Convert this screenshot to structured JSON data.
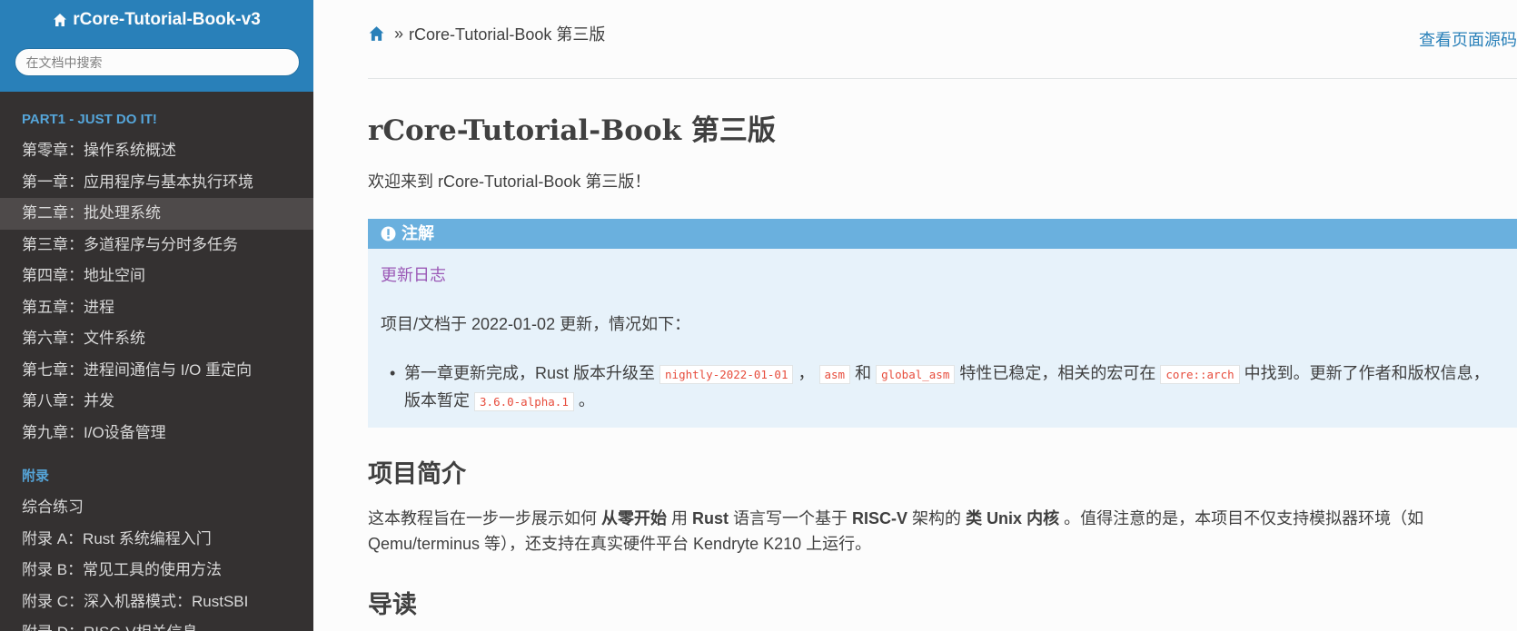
{
  "sidebar": {
    "brand": "rCore-Tutorial-Book-v3",
    "search_placeholder": "在文档中搜索",
    "caption_part1": "PART1 - JUST DO IT!",
    "part1_items": [
      {
        "label": "第零章：操作系统概述"
      },
      {
        "label": "第一章：应用程序与基本执行环境"
      },
      {
        "label": "第二章：批处理系统"
      },
      {
        "label": "第三章：多道程序与分时多任务"
      },
      {
        "label": "第四章：地址空间"
      },
      {
        "label": "第五章：进程"
      },
      {
        "label": "第六章：文件系统"
      },
      {
        "label": "第七章：进程间通信与 I/O 重定向"
      },
      {
        "label": "第八章：并发"
      },
      {
        "label": "第九章：I/O设备管理"
      }
    ],
    "caption_appendix": "附录",
    "appendix_items": [
      {
        "label": "综合练习"
      },
      {
        "label": "附录 A：Rust 系统编程入门"
      },
      {
        "label": "附录 B：常见工具的使用方法"
      },
      {
        "label": "附录 C：深入机器模式：RustSBI"
      },
      {
        "label": "附录 D：RISC-V相关信息"
      }
    ]
  },
  "main": {
    "breadcrumb_sep": "»",
    "breadcrumb_current": "rCore-Tutorial-Book 第三版",
    "view_source": "查看页面源码",
    "title": "rCore-Tutorial-Book 第三版",
    "welcome": "欢迎来到 rCore-Tutorial-Book 第三版！",
    "note": {
      "title": "注解",
      "link": "更新日志",
      "para": "项目/文档于 2022-01-02 更新，情况如下：",
      "bullet": "•",
      "li_t1": "第一章更新完成，Rust 版本升级至 ",
      "li_c1": "nightly-2022-01-01",
      "li_t2": " ，  ",
      "li_c2": "asm",
      "li_t3": " 和 ",
      "li_c3": "global_asm",
      "li_t4": " 特性已稳定，相关的宏可在 ",
      "li_c4": "core::arch",
      "li_t5": " 中找到。更新了作者和版权信息，版本暂定 ",
      "li_c5": "3.6.0-alpha.1",
      "li_t6": " 。"
    },
    "section1_title": "项目简介",
    "intro": {
      "t1": "这本教程旨在一步一步展示如何 ",
      "b1": "从零开始",
      "t2": " 用 ",
      "b2": "Rust",
      "t3": " 语言写一个基于 ",
      "b3": "RISC-V",
      "t4": " 架构的 ",
      "b4": "类 Unix 内核",
      "t5": " 。值得注意的是，本项目不仅支持模拟器环境（如 Qemu/terminus 等），还支持在真实硬件平台 Kendryte K210 上运行。"
    },
    "section2_title": "导读"
  },
  "colors": {
    "sidebar_bg": "#343131",
    "brand_bg": "#2980b9",
    "caption": "#55a5d9",
    "note_header": "#6ab0de",
    "note_bg": "#e7f2fa",
    "link_visited": "#9b59b6",
    "code": "#e74c3c"
  },
  "icons": {
    "brand": "home-icon",
    "breadcrumb_home": "home-icon",
    "note": "exclamation-circle-icon"
  }
}
